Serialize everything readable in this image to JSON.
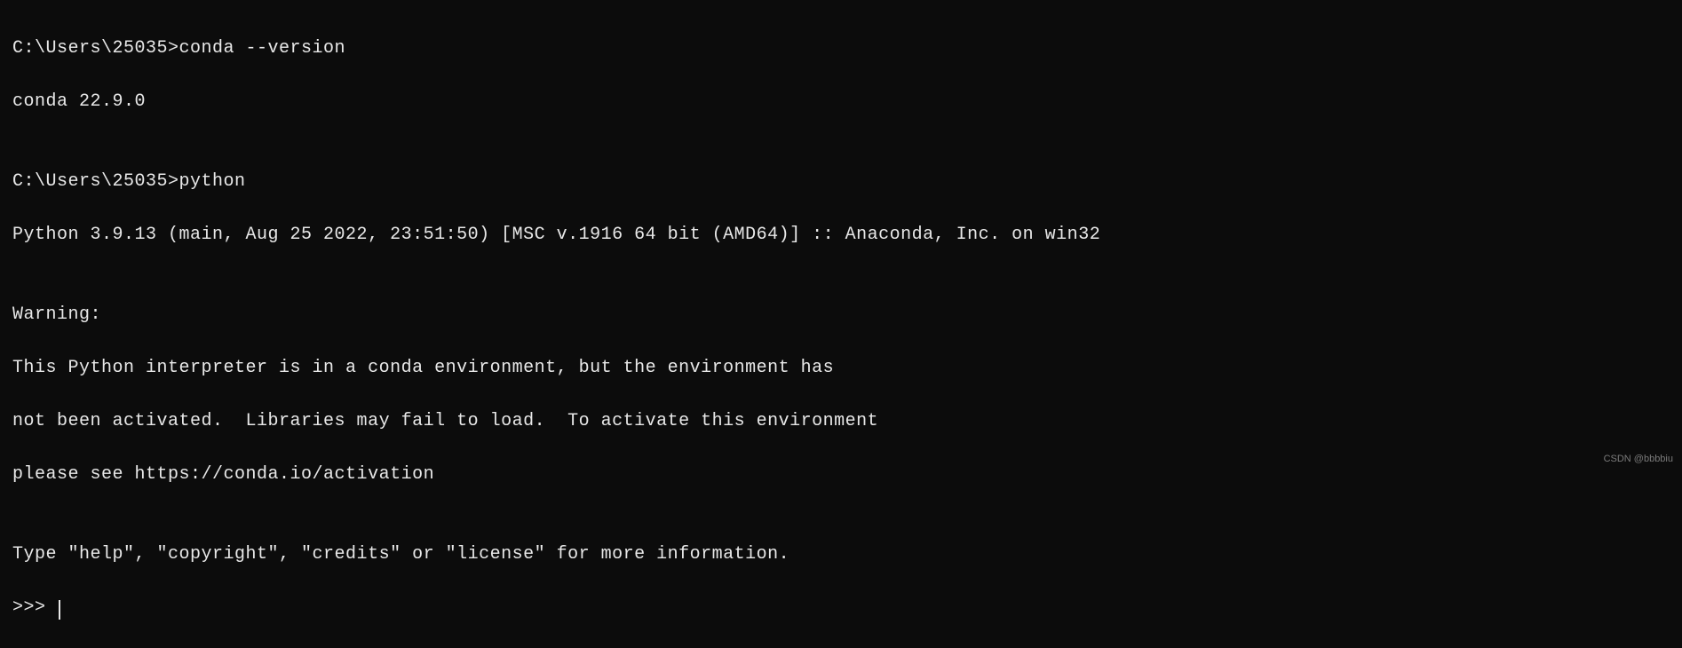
{
  "terminal": {
    "line1_prompt": "C:\\Users\\25035>",
    "line1_cmd": "conda --version",
    "line2_output": "conda 22.9.0",
    "blank1": "",
    "line3_prompt": "C:\\Users\\25035>",
    "line3_cmd": "python",
    "line4_output": "Python 3.9.13 (main, Aug 25 2022, 23:51:50) [MSC v.1916 64 bit (AMD64)] :: Anaconda, Inc. on win32",
    "blank2": "",
    "line5_output": "Warning:",
    "line6_output": "This Python interpreter is in a conda environment, but the environment has",
    "line7_output": "not been activated.  Libraries may fail to load.  To activate this environment",
    "line8_output": "please see https://conda.io/activation",
    "blank3": "",
    "line9_output": "Type \"help\", \"copyright\", \"credits\" or \"license\" for more information.",
    "line10_prompt": ">>> "
  },
  "watermark": "CSDN @bbbbiu"
}
